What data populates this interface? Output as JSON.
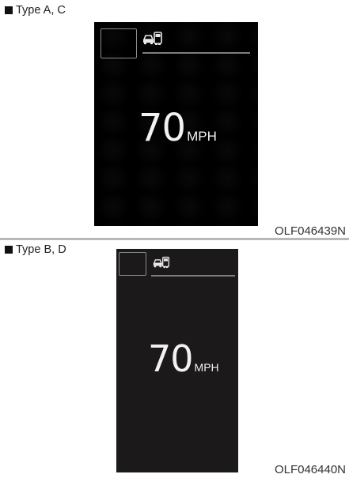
{
  "panels": [
    {
      "label": "Type A, C",
      "figure_code": "OLF046439N",
      "display": {
        "speed_value": "70",
        "speed_unit": "MPH",
        "icon": "vehicle-distance-icon",
        "background": "#000000"
      }
    },
    {
      "label": "Type B, D",
      "figure_code": "OLF046440N",
      "display": {
        "speed_value": "70",
        "speed_unit": "MPH",
        "icon": "vehicle-distance-icon",
        "background": "#1b1919"
      }
    }
  ]
}
